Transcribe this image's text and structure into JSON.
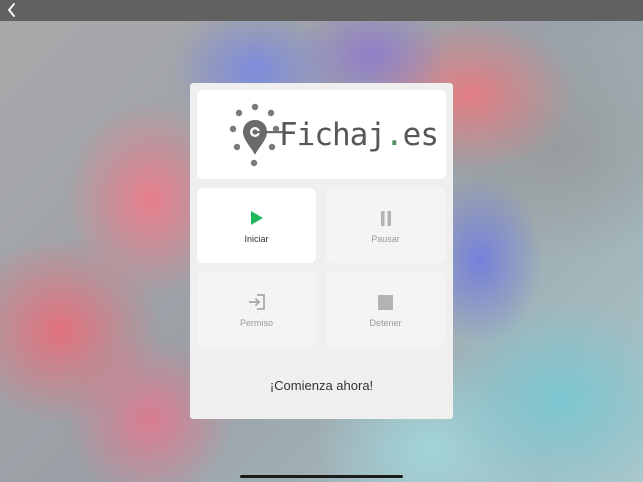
{
  "header": {
    "back_icon": "chevron-left-icon"
  },
  "logo": {
    "main": "Fichaj",
    "dot": ".",
    "tld": "es",
    "icon": "clock-location-pin-icon"
  },
  "actions": [
    {
      "label": "Iniciar",
      "icon": "play-icon",
      "enabled": true
    },
    {
      "label": "Pausar",
      "icon": "pause-icon",
      "enabled": false
    },
    {
      "label": "Permiso",
      "icon": "sign-in-icon",
      "enabled": false
    },
    {
      "label": "Detener",
      "icon": "stop-icon",
      "enabled": false
    }
  ],
  "cta": "¡Comienza ahora!",
  "colors": {
    "play": "#1fb75a",
    "disabled_icon": "#b3b3b3",
    "logo_accent": "#4f8f58",
    "logo_text": "#575757",
    "top_bar": "#616161"
  }
}
